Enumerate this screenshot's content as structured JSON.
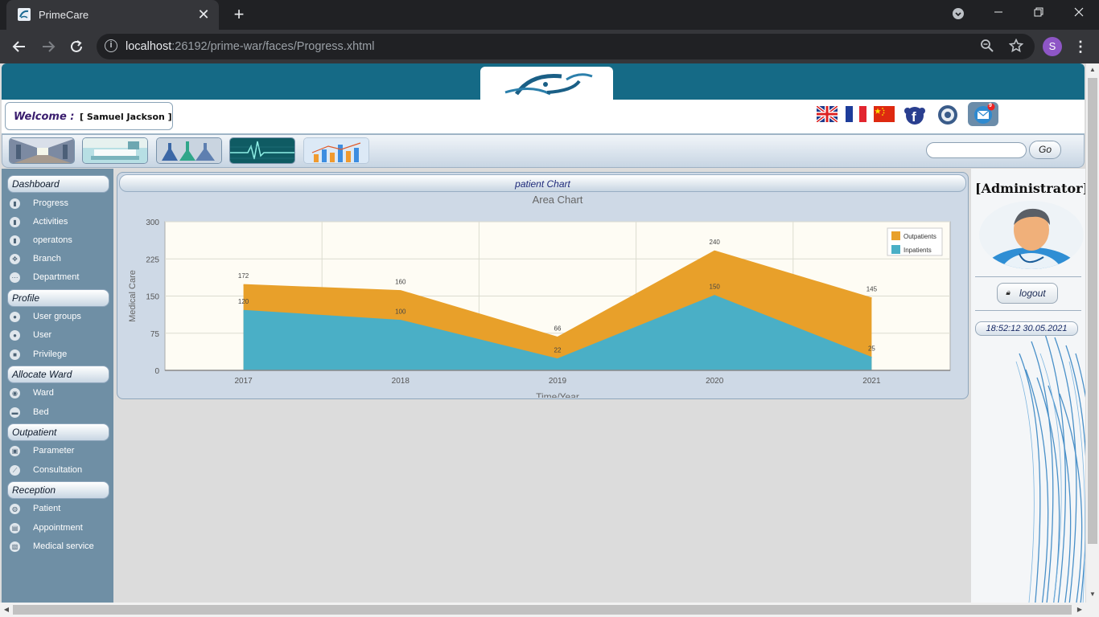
{
  "browser": {
    "tab_title": "PrimeCare",
    "url_host": "localhost",
    "url_rest": ":26192/prime-war/faces/Progress.xhtml",
    "profile_initial": "S",
    "tab_close": "✕",
    "new_tab": "+"
  },
  "header": {
    "welcome_label": "Welcome :",
    "user_name": "[ Samuel Jackson ]",
    "languages": [
      "english-flag",
      "french-flag",
      "chinese-flag"
    ],
    "icons": [
      "facebook-icon",
      "settings-icon",
      "mail-icon"
    ],
    "mail_badge": "9",
    "accent_color": "#156a86"
  },
  "menubar": {
    "thumbs": [
      "corridor",
      "ward-bed",
      "laboratory",
      "heart-monitor",
      "statistics"
    ],
    "search_placeholder": "",
    "go_label": "Go"
  },
  "sidebar": {
    "sections": [
      {
        "title": "Dashboard",
        "items": [
          {
            "label": "Progress",
            "icon": "chart-icon"
          },
          {
            "label": "Activities",
            "icon": "chart-icon"
          },
          {
            "label": "operatons",
            "icon": "chart-icon"
          },
          {
            "label": "Branch",
            "icon": "branch-icon"
          },
          {
            "label": "Department",
            "icon": "department-icon"
          }
        ]
      },
      {
        "title": "Profile",
        "items": [
          {
            "label": "User groups",
            "icon": "user-group-icon"
          },
          {
            "label": "User",
            "icon": "user-icon"
          },
          {
            "label": "Privilege",
            "icon": "lock-icon"
          }
        ]
      },
      {
        "title": "Allocate Ward",
        "items": [
          {
            "label": "Ward",
            "icon": "ward-icon"
          },
          {
            "label": "Bed",
            "icon": "bed-icon"
          }
        ]
      },
      {
        "title": "Outpatient",
        "items": [
          {
            "label": "Parameter",
            "icon": "parameter-icon"
          },
          {
            "label": "Consultation",
            "icon": "stethoscope-icon"
          }
        ]
      },
      {
        "title": "Reception",
        "items": [
          {
            "label": "Patient",
            "icon": "patient-icon"
          },
          {
            "label": "Appointment",
            "icon": "appointment-icon"
          },
          {
            "label": "Medical service",
            "icon": "service-icon"
          }
        ]
      }
    ]
  },
  "panel": {
    "title": "patient Chart"
  },
  "chart_data": {
    "type": "area",
    "title": "Area Chart",
    "xlabel": "Time/Year",
    "ylabel": "Medical Care",
    "categories": [
      "2017",
      "2018",
      "2019",
      "2020",
      "2021"
    ],
    "ylim": [
      0,
      300
    ],
    "yticks": [
      "0",
      "75",
      "150",
      "225",
      "300"
    ],
    "series": [
      {
        "name": "Outpatients",
        "values": [
          172,
          160,
          66,
          240,
          145
        ],
        "color": "#e8a02a"
      },
      {
        "name": "Inpatients",
        "values": [
          120,
          100,
          22,
          150,
          25
        ],
        "color": "#4aafc6"
      }
    ],
    "legend": "top-right",
    "grid": true
  },
  "rightpanel": {
    "role": "[Administrator]",
    "logout_label": "logout",
    "clock": "18:52:12 30.05.2021"
  }
}
